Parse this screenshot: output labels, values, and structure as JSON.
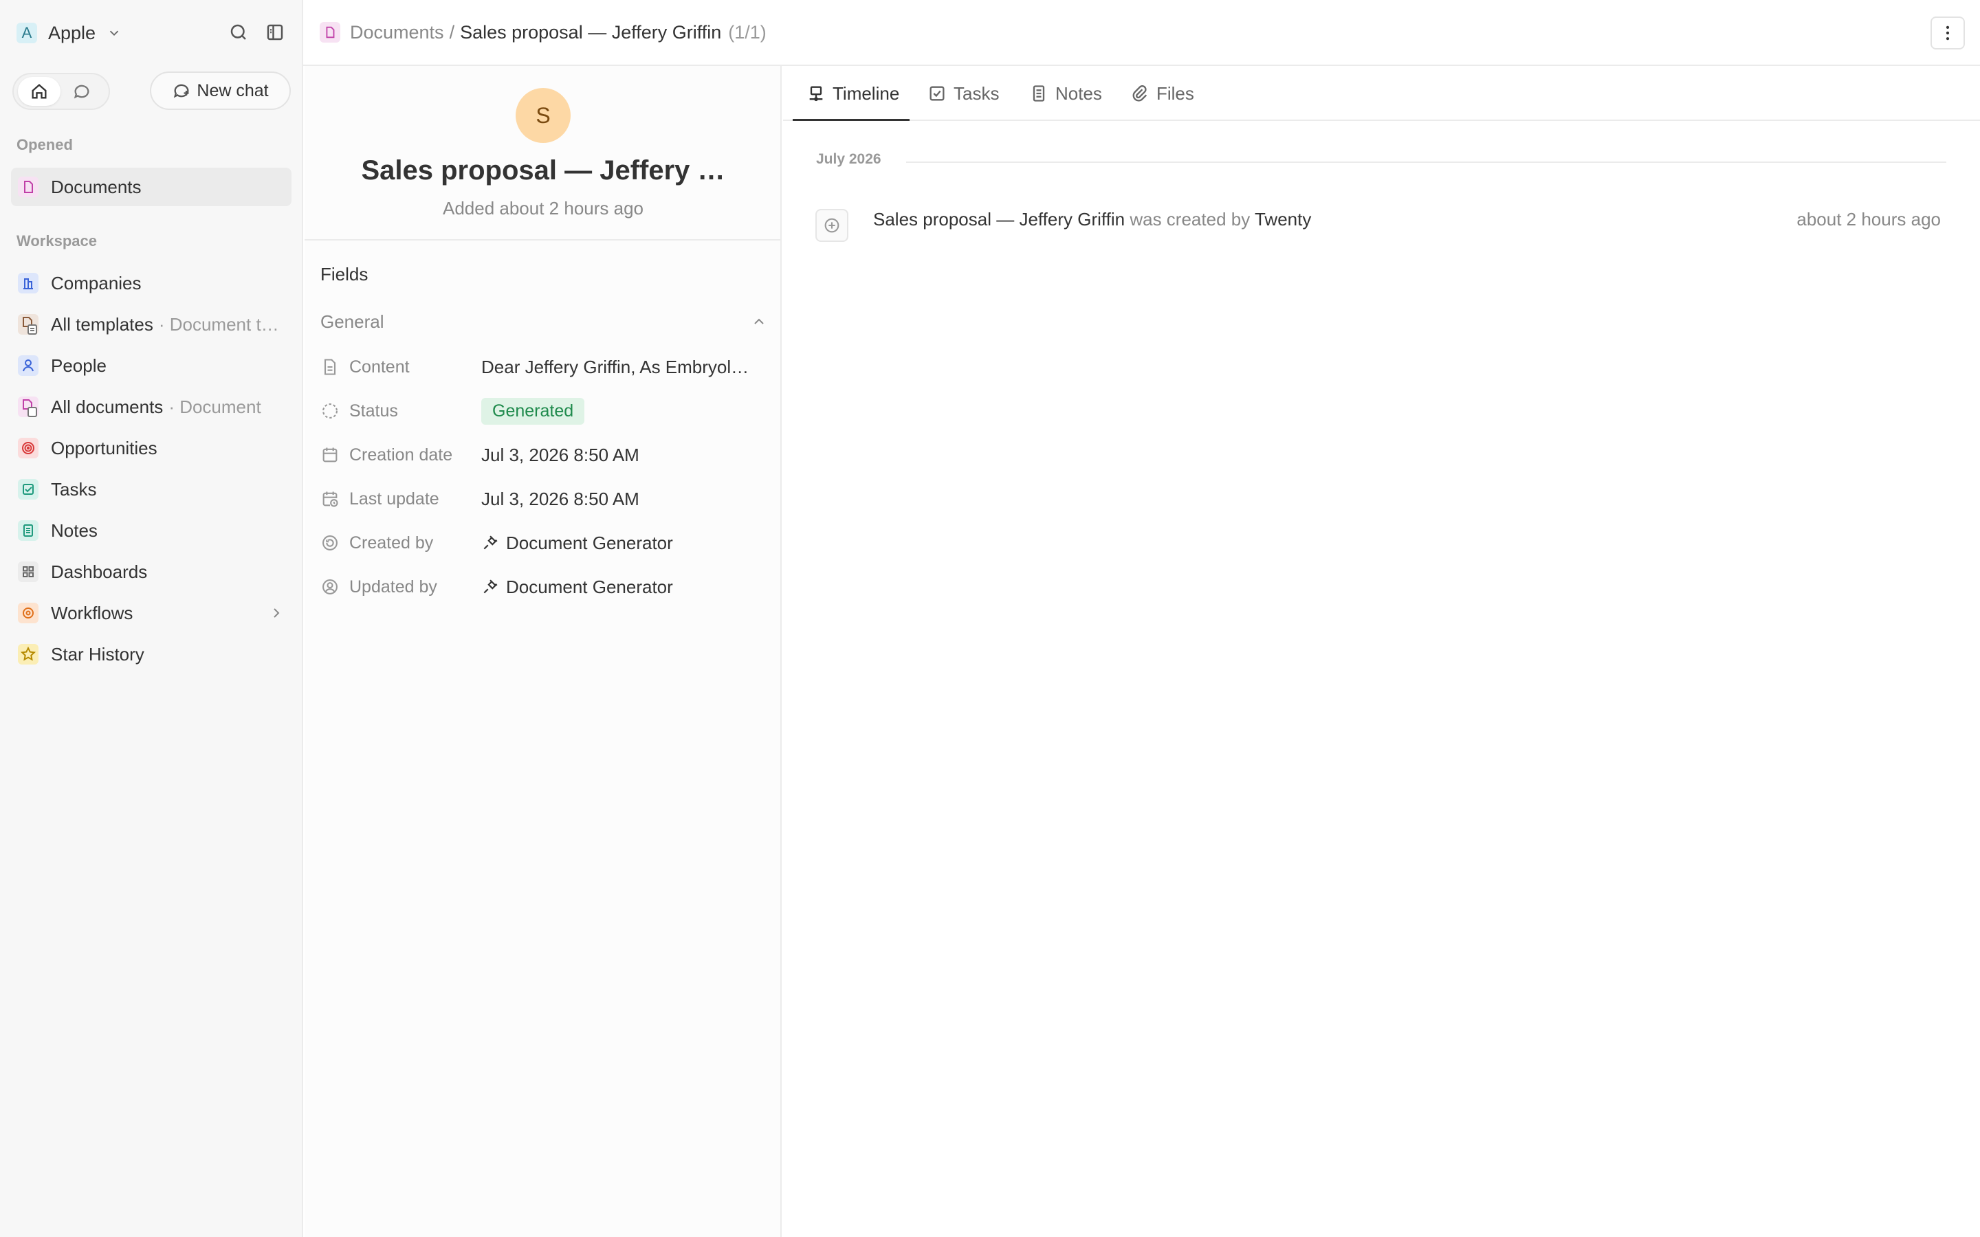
{
  "workspace": {
    "logo_letter": "A",
    "name": "Apple"
  },
  "sidebar": {
    "new_chat_label": "New chat",
    "opened_label": "Opened",
    "opened_items": [
      {
        "label": "Documents",
        "icon": "document-icon"
      }
    ],
    "workspace_label": "Workspace",
    "items": [
      {
        "label": "Companies",
        "sub": "",
        "icon": "building-icon"
      },
      {
        "label": "All templates",
        "sub": "· Document t…",
        "icon": "template-icon"
      },
      {
        "label": "People",
        "sub": "",
        "icon": "user-icon"
      },
      {
        "label": "All documents",
        "sub": "· Document",
        "icon": "document-icon"
      },
      {
        "label": "Opportunities",
        "sub": "",
        "icon": "target-icon"
      },
      {
        "label": "Tasks",
        "sub": "",
        "icon": "checkbox-icon"
      },
      {
        "label": "Notes",
        "sub": "",
        "icon": "note-icon"
      },
      {
        "label": "Dashboards",
        "sub": "",
        "icon": "grid-icon"
      },
      {
        "label": "Workflows",
        "sub": "",
        "icon": "workflow-icon"
      },
      {
        "label": "Star History",
        "sub": "",
        "icon": "star-icon"
      }
    ]
  },
  "breadcrumb": {
    "root": "Documents",
    "separator": "/",
    "title": "Sales proposal — Jeffery Griffin",
    "count": "(1/1)"
  },
  "record": {
    "avatar_letter": "S",
    "title": "Sales proposal — Jeffery …",
    "subtitle": "Added about 2 hours ago",
    "fields_title": "Fields",
    "group_label": "General",
    "fields": [
      {
        "label": "Content",
        "value": "Dear Jeffery Griffin, As Embryol…",
        "icon": "file-text-icon"
      },
      {
        "label": "Status",
        "value": "Generated",
        "icon": "status-icon"
      },
      {
        "label": "Creation date",
        "value": "Jul 3, 2026 8:50 AM",
        "icon": "calendar-icon"
      },
      {
        "label": "Last update",
        "value": "Jul 3, 2026 8:50 AM",
        "icon": "calendar-clock-icon"
      },
      {
        "label": "Created by",
        "value": "Document Generator",
        "icon": "history-icon"
      },
      {
        "label": "Updated by",
        "value": "Document Generator",
        "icon": "user-circle-icon"
      }
    ]
  },
  "tabs": [
    {
      "label": "Timeline",
      "icon": "timeline-icon",
      "active": true
    },
    {
      "label": "Tasks",
      "icon": "checkbox-icon",
      "active": false
    },
    {
      "label": "Notes",
      "icon": "note-icon",
      "active": false
    },
    {
      "label": "Files",
      "icon": "paperclip-icon",
      "active": false
    }
  ],
  "timeline": {
    "month": "July 2026",
    "event": {
      "subject": "Sales proposal — Jeffery Griffin",
      "verb": "was created by",
      "actor": "Twenty",
      "time": "about 2 hours ago"
    }
  },
  "colors": {
    "accent": "#333333",
    "status_bg": "#dff3e6",
    "status_fg": "#1f8a4c",
    "avatar_bg": "#fdd8a5"
  }
}
